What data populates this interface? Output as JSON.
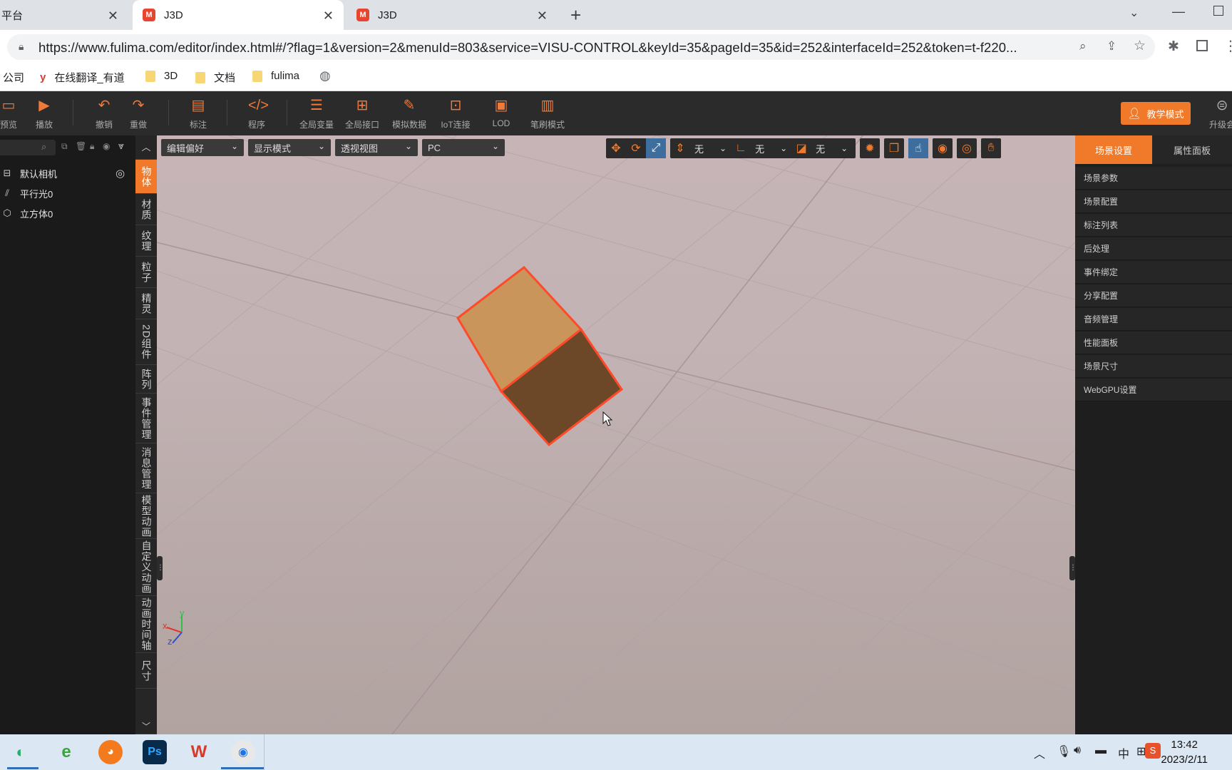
{
  "browser": {
    "tabs": [
      {
        "label": "平台",
        "active": false
      },
      {
        "label": "J3D",
        "active": true
      },
      {
        "label": "J3D",
        "active": false
      }
    ],
    "url": "https://www.fulima.com/editor/index.html#/?flag=1&version=2&menuId=803&service=VISU-CONTROL&keyId=35&pageId=35&id=252&interfaceId=252&token=t-f220...",
    "bookmarks": [
      "公司",
      "在线翻译_有道",
      "3D",
      "文档",
      "fulima"
    ]
  },
  "toolbar": {
    "items": [
      "预览",
      "播放",
      "撤销",
      "重做",
      "标注",
      "程序",
      "全局变量",
      "全局接口",
      "模拟数据",
      "IoT连接",
      "LOD",
      "笔刷模式"
    ],
    "teach_mode": "教学模式",
    "upgrade": "升级会"
  },
  "scene_tree": {
    "items": [
      "默认相机",
      "平行光0",
      "立方体0"
    ]
  },
  "vertical_tabs": [
    "物体",
    "材质",
    "纹理",
    "粒子",
    "精灵",
    "2D组件",
    "阵列",
    "事件管理",
    "消息管理",
    "模型动画",
    "自定义动画",
    "动画时间轴",
    "尺寸"
  ],
  "viewport": {
    "dropdowns": [
      "编辑偏好",
      "显示模式",
      "透视视图",
      "PC"
    ],
    "snap_selects": [
      "无",
      "无",
      "无"
    ],
    "axis_labels": {
      "x": "x",
      "y": "y",
      "z": "z"
    }
  },
  "right_panel": {
    "tabs": [
      "场景设置",
      "属性面板"
    ],
    "items": [
      "场景参数",
      "场景配置",
      "标注列表",
      "后处理",
      "事件绑定",
      "分享配置",
      "音频管理",
      "性能面板",
      "场景尺寸",
      "WebGPU设置"
    ]
  },
  "taskbar": {
    "time": "13:42",
    "date": "2023/2/11",
    "ime": "中"
  },
  "colors": {
    "accent": "#f07a2a",
    "cube_top": "#c9955a",
    "cube_front": "#6d4828",
    "cube_outline": "#ff4a2a"
  }
}
